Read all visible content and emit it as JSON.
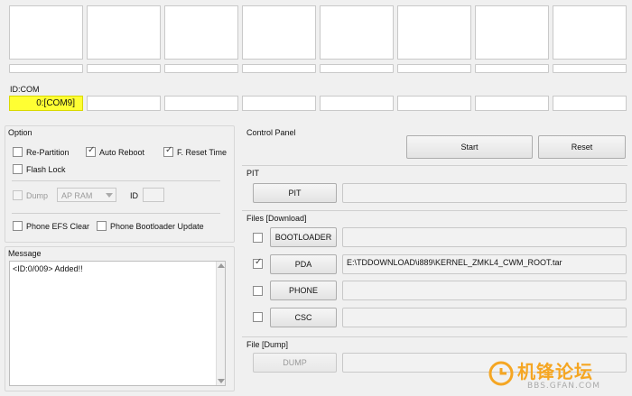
{
  "idcom_label": "ID:COM",
  "com_ports": [
    "0:[COM9]",
    "",
    "",
    "",
    "",
    "",
    "",
    ""
  ],
  "option": {
    "title": "Option",
    "repartition": {
      "label": "Re-Partition",
      "checked": false
    },
    "auto_reboot": {
      "label": "Auto Reboot",
      "checked": true
    },
    "f_reset_time": {
      "label": "F. Reset Time",
      "checked": true
    },
    "flash_lock": {
      "label": "Flash Lock",
      "checked": false
    },
    "dump": {
      "label": "Dump",
      "checked": false,
      "enabled": false
    },
    "dump_select": "AP RAM",
    "id_label": "ID",
    "phone_efs_clear": {
      "label": "Phone EFS Clear",
      "checked": false
    },
    "phone_bootloader_update": {
      "label": "Phone Bootloader Update",
      "checked": false
    }
  },
  "message": {
    "title": "Message",
    "text": "<ID:0/009> Added!!"
  },
  "control_panel": {
    "title": "Control Panel",
    "start": "Start",
    "reset": "Reset"
  },
  "pit": {
    "title": "PIT",
    "button": "PIT",
    "path": ""
  },
  "files": {
    "title": "Files [Download]",
    "rows": [
      {
        "button": "BOOTLOADER",
        "checked": false,
        "path": ""
      },
      {
        "button": "PDA",
        "checked": true,
        "path": "E:\\TDDOWNLOAD\\i889\\KERNEL_ZMKL4_CWM_ROOT.tar"
      },
      {
        "button": "PHONE",
        "checked": false,
        "path": ""
      },
      {
        "button": "CSC",
        "checked": false,
        "path": ""
      }
    ]
  },
  "file_dump": {
    "title": "File [Dump]",
    "button": "DUMP",
    "path": ""
  },
  "watermark": {
    "brand": "机锋论坛",
    "url": "BBS.GFAN.COM"
  },
  "colors": {
    "active_com": "#ffff33",
    "watermark": "#f5a623"
  }
}
